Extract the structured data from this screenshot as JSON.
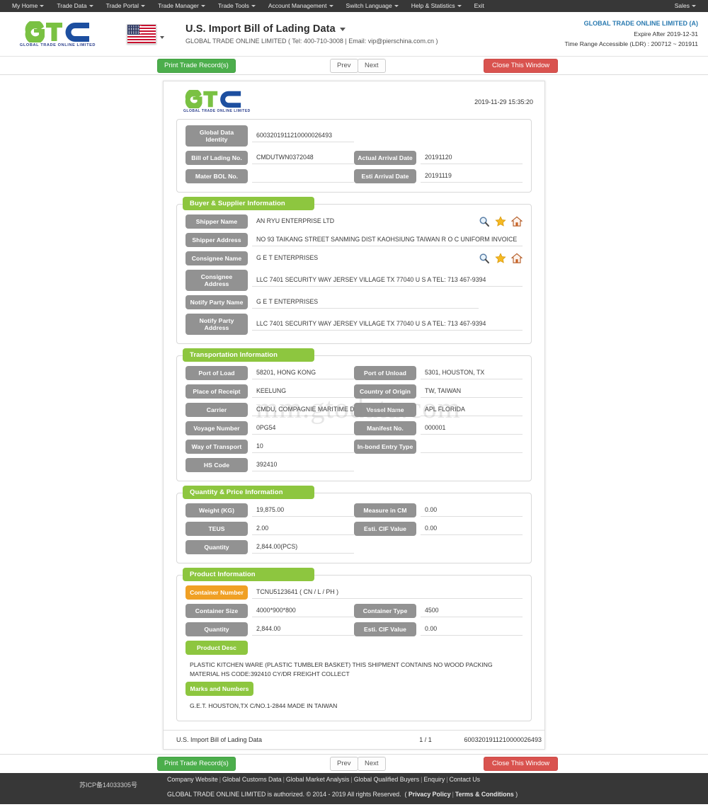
{
  "nav": {
    "items": [
      {
        "label": "My Home",
        "caret": true
      },
      {
        "label": "Trade Data",
        "caret": true
      },
      {
        "label": "Trade Portal",
        "caret": true
      },
      {
        "label": "Trade Manager",
        "caret": true
      },
      {
        "label": "Trade Tools",
        "caret": true
      },
      {
        "label": "Account Management",
        "caret": true
      },
      {
        "label": "Switch Language",
        "caret": true
      },
      {
        "label": "Help & Statistics",
        "caret": true
      },
      {
        "label": "Exit",
        "caret": false
      }
    ],
    "right": {
      "label": "Sales",
      "caret": true
    }
  },
  "header": {
    "logo_text": "GLOBAL TRADE ONLINE LIMITED",
    "flag_icon": "us-flag-icon",
    "title": "U.S. Import Bill of Lading Data",
    "subtitle": "GLOBAL TRADE ONLINE LIMITED ( Tel: 400-710-3008 | Email: vip@pierschina.com.cn )",
    "account_name": "GLOBAL TRADE ONLINE LIMITED (A)",
    "expire": "Expire After 2019-12-31",
    "time_range": "Time Range Accessible (LDR) : 200712 ~ 201911"
  },
  "actions": {
    "print": "Print Trade Record(s)",
    "prev": "Prev",
    "next": "Next",
    "close": "Close This Window"
  },
  "document": {
    "logo_text": "GLOBAL TRADE ONLINE LIMITED",
    "timestamp": "2019-11-29 15:35:20",
    "watermark": "mm.gtodata.com",
    "identity": {
      "global_data_identity_label": "Global Data Identity",
      "global_data_identity_value": "6003201911210000026493",
      "bol_label": "Bill of Lading No.",
      "bol_value": "CMDUTWN0372048",
      "actual_arrival_label": "Actual Arrival Date",
      "actual_arrival_value": "20191120",
      "master_bol_label": "Mater BOL No.",
      "master_bol_value": "",
      "esti_arrival_label": "Esti Arrival Date",
      "esti_arrival_value": "20191119"
    },
    "buyer_supplier": {
      "title": "Buyer & Supplier Information",
      "shipper_name_label": "Shipper Name",
      "shipper_name_value": "AN RYU ENTERPRISE LTD",
      "shipper_address_label": "Shipper Address",
      "shipper_address_value": "NO 93 TAIKANG STREET SANMING DIST KAOHSIUNG TAIWAN R O C UNIFORM INVOICE",
      "consignee_name_label": "Consignee Name",
      "consignee_name_value": "G E T ENTERPRISES",
      "consignee_address_label": "Consignee Address",
      "consignee_address_value": "LLC 7401 SECURITY WAY JERSEY VILLAGE TX 77040 U S A TEL: 713 467-9394",
      "notify_name_label": "Notify Party Name",
      "notify_name_value": "G E T ENTERPRISES",
      "notify_address_label": "Notify Party Address",
      "notify_address_value": "LLC 7401 SECURITY WAY JERSEY VILLAGE TX 77040 U S A TEL: 713 467-9394"
    },
    "transportation": {
      "title": "Transportation Information",
      "port_of_load_label": "Port of Load",
      "port_of_load_value": "58201, HONG KONG",
      "port_of_unload_label": "Port of Unload",
      "port_of_unload_value": "5301, HOUSTON, TX",
      "place_of_receipt_label": "Place of Receipt",
      "place_of_receipt_value": "KEELUNG",
      "country_of_origin_label": "Country of Origin",
      "country_of_origin_value": "TW, TAIWAN",
      "carrier_label": "Carrier",
      "carrier_value": "CMDU, COMPAGNIE MARITIME DAF",
      "vessel_name_label": "Vessel Name",
      "vessel_name_value": "APL FLORIDA",
      "voyage_label": "Voyage Number",
      "voyage_value": "0PG54",
      "manifest_label": "Manifest No.",
      "manifest_value": "000001",
      "way_of_transport_label": "Way of Transport",
      "way_of_transport_value": "10",
      "inbond_label": "In-bond Entry Type",
      "inbond_value": "",
      "hs_code_label": "HS Code",
      "hs_code_value": "392410"
    },
    "quantity_price": {
      "title": "Quantity & Price Information",
      "weight_label": "Weight (KG)",
      "weight_value": "19,875.00",
      "measure_label": "Measure in CM",
      "measure_value": "0.00",
      "teus_label": "TEUS",
      "teus_value": "2.00",
      "cif_label": "Esti. CIF Value",
      "cif_value": "0.00",
      "quantity_label": "Quantity",
      "quantity_value": "2,844.00(PCS)"
    },
    "product": {
      "title": "Product Information",
      "container_number_label": "Container Number",
      "container_number_value": "TCNU5123641 ( CN / L / PH )",
      "container_size_label": "Container Size",
      "container_size_value": "4000*900*800",
      "container_type_label": "Container Type",
      "container_type_value": "4500",
      "quantity_label": "Quantity",
      "quantity_value": "2,844.00",
      "cif_label": "Esti. CIF Value",
      "cif_value": "0.00",
      "product_desc_label": "Product Desc",
      "product_desc_value": "PLASTIC KITCHEN WARE (PLASTIC TUMBLER BASKET) THIS SHIPMENT CONTAINS NO WOOD PACKING MATERIAL HS CODE:392410 CY/DR FREIGHT COLLECT",
      "marks_label": "Marks and Numbers",
      "marks_value": "G.E.T. HOUSTON,TX C/NO.1-2844 MADE IN TAIWAN"
    },
    "footer": {
      "left": "U.S. Import Bill of Lading Data",
      "page": "1 / 1",
      "right": "6003201911210000026493"
    }
  },
  "page_footer": {
    "icp": "苏ICP备14033305号",
    "links": [
      "Company Website",
      "Global Customs Data",
      "Global Market Analysis",
      "Global Qualified Buyers",
      "Enquiry",
      "Contact Us"
    ],
    "copyright": "GLOBAL TRADE ONLINE LIMITED is authorized. © 2014 - 2019 All rights Reserved.",
    "privacy": "Privacy Policy",
    "terms": "Terms & Conditions"
  },
  "colors": {
    "nav_bg": "#373737",
    "green": "#8dc63f",
    "orange": "#f0a024",
    "label_gray": "#929292",
    "accent_blue": "#2a7ab0",
    "danger_red": "#d9534f",
    "success_green": "#4cae4c"
  }
}
